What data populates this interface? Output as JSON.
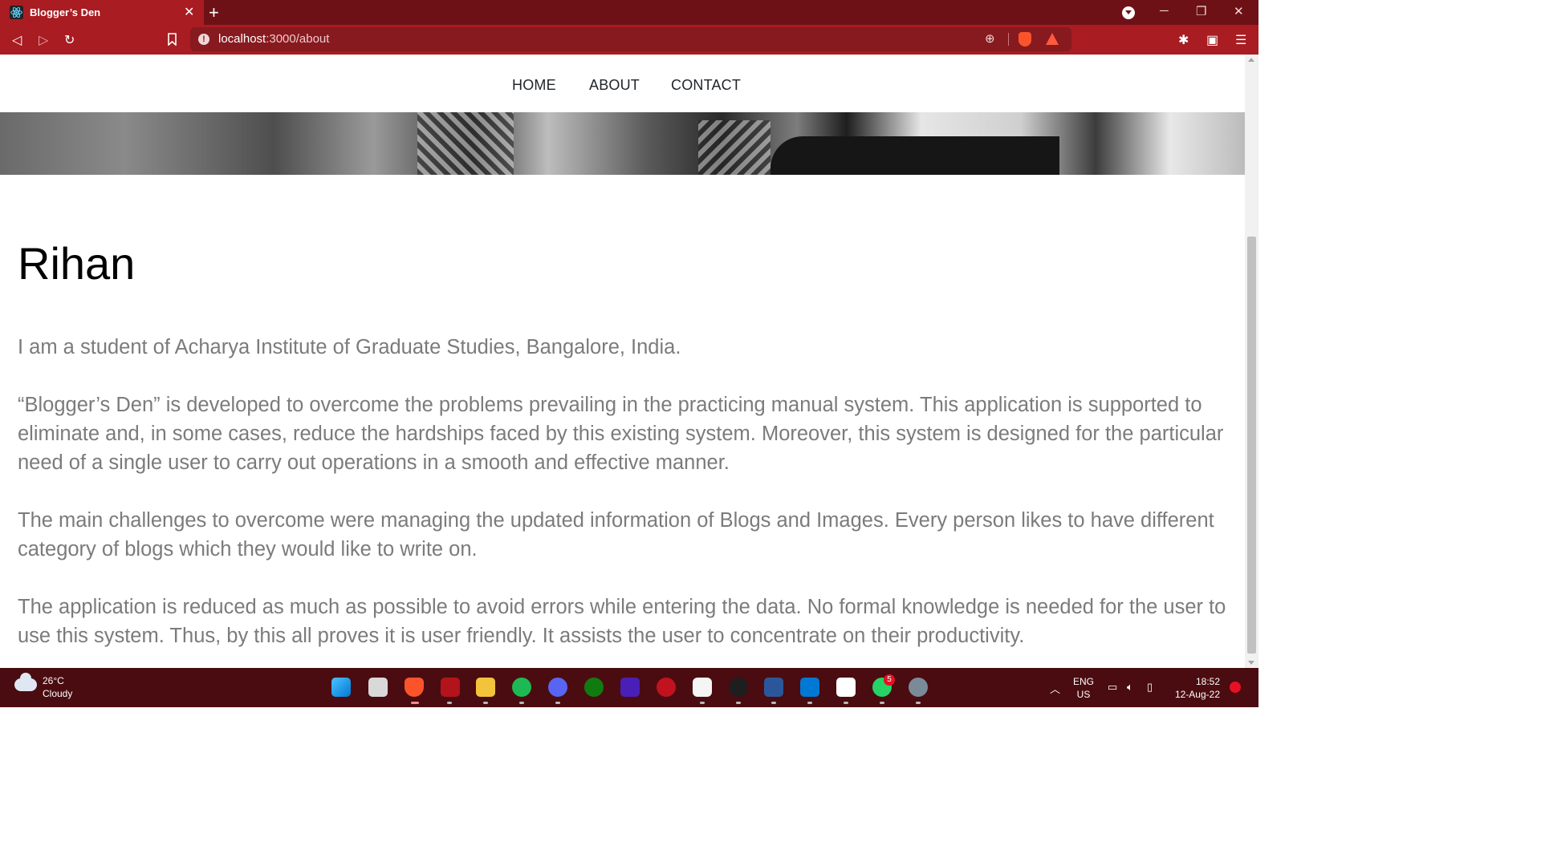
{
  "browser": {
    "tab_title": "Blogger’s Den",
    "url_host": "localhost",
    "url_path": ":3000/about",
    "accent": "#a81c22"
  },
  "nav": {
    "items": [
      "HOME",
      "ABOUT",
      "CONTACT"
    ]
  },
  "about": {
    "heading": "Rihan",
    "paragraphs": [
      "I am a student of Acharya Institute of Graduate Studies, Bangalore, India.",
      "“Blogger’s Den” is developed to overcome the problems prevailing in the practicing manual system. This application is supported to eliminate and, in some cases, reduce the hardships faced by this existing system. Moreover, this system is designed for the particular need of a single user to carry out operations in a smooth and effective manner.",
      "The main challenges to overcome were managing the updated information of Blogs and Images. Every person likes to have different category of blogs which they would like to write on.",
      "The application is reduced as much as possible to avoid errors while entering the data. No formal knowledge is needed for the user to use this system. Thus, by this all proves it is user friendly. It assists the user to concentrate on their productivity."
    ]
  },
  "taskbar": {
    "weather_temp": "26°C",
    "weather_condition": "Cloudy",
    "whatsapp_badge": "5",
    "lang_top": "ENG",
    "lang_bottom": "US",
    "time": "18:52",
    "date": "12-Aug-22",
    "icons": [
      "windows-start-icon",
      "task-view-icon",
      "brave-icon",
      "app-red-icon",
      "file-explorer-icon",
      "spotify-icon",
      "discord-icon",
      "xbox-icon",
      "amazon-music-icon",
      "app-circle-icon",
      "cat-app-icon",
      "logitech-icon",
      "word-icon",
      "vscode-icon",
      "notion-icon",
      "whatsapp-icon",
      "settings-icon"
    ]
  }
}
